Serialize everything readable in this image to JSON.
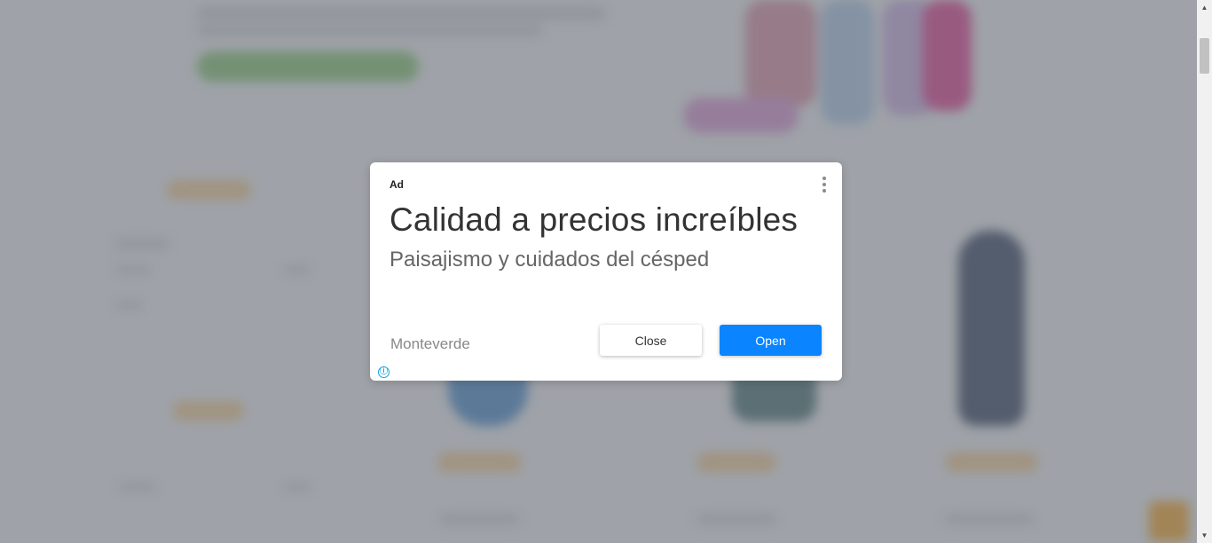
{
  "ad": {
    "label": "Ad",
    "headline": "Calidad a precios increíbles",
    "subheadline": "Paisajismo y cuidados del césped",
    "advertiser": "Monteverde",
    "close_label": "Close",
    "open_label": "Open",
    "info_glyph": "ⓘ",
    "menu_icon": "more-vert-icon",
    "colors": {
      "open_button": "#0a84ff",
      "info_icon": "#13a6d8"
    }
  },
  "scrollbar": {
    "up_glyph": "▲",
    "down_glyph": "▼"
  }
}
